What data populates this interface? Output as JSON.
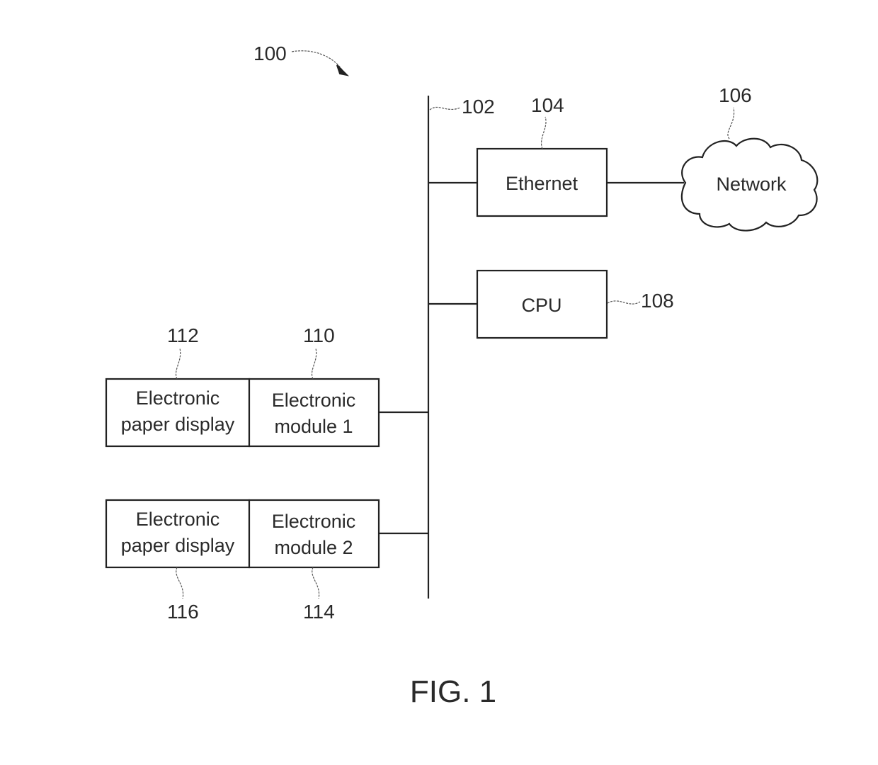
{
  "figure": {
    "caption": "FIG. 1",
    "system_ref": "100"
  },
  "bus": {
    "ref": "102"
  },
  "nodes": {
    "ethernet": {
      "label": "Ethernet",
      "ref": "104"
    },
    "network": {
      "label": "Network",
      "ref": "106"
    },
    "cpu": {
      "label": "CPU",
      "ref": "108"
    },
    "module1": {
      "line1": "Electronic",
      "line2": "module 1",
      "ref": "110"
    },
    "display1": {
      "line1": "Electronic",
      "line2": "paper display",
      "ref": "112"
    },
    "module2": {
      "line1": "Electronic",
      "line2": "module 2",
      "ref": "114"
    },
    "display2": {
      "line1": "Electronic",
      "line2": "paper display",
      "ref": "116"
    }
  },
  "colors": {
    "ink": "#222222",
    "background": "#ffffff"
  }
}
